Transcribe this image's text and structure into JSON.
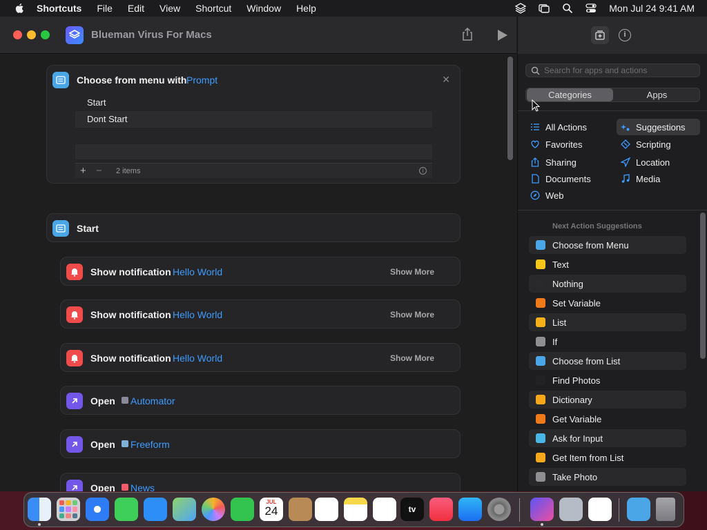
{
  "menubar": {
    "app": "Shortcuts",
    "items": [
      "File",
      "Edit",
      "View",
      "Shortcut",
      "Window",
      "Help"
    ],
    "clock": "Mon Jul 24  9:41 AM"
  },
  "window": {
    "title": "Blueman Virus For Macs"
  },
  "menu_card": {
    "label": "Choose from menu with",
    "token": "Prompt",
    "items": [
      "Start",
      "Dont Start"
    ],
    "count": "2 items"
  },
  "start_header": {
    "label": "Start"
  },
  "actions": [
    {
      "label": "Show notification",
      "token": "Hello World",
      "more": "Show More"
    },
    {
      "label": "Show notification",
      "token": "Hello World",
      "more": "Show More"
    },
    {
      "label": "Show notification",
      "token": "Hello World",
      "more": "Show More"
    },
    {
      "label": "Open",
      "token": "Automator"
    },
    {
      "label": "Open",
      "token": "Freeform"
    },
    {
      "label": "Open",
      "token": "News"
    }
  ],
  "sidebar": {
    "search_placeholder": "Search for apps and actions",
    "seg_categories": "Categories",
    "seg_apps": "Apps",
    "categories_left": [
      "All Actions",
      "Favorites",
      "Sharing",
      "Documents",
      "Web"
    ],
    "categories_right": [
      "Suggestions",
      "Scripting",
      "Location",
      "Media"
    ],
    "next_title": "Next Action Suggestions",
    "suggestions": [
      {
        "label": "Choose from Menu",
        "color": "#4aa6e6"
      },
      {
        "label": "Text",
        "color": "#f5c518"
      },
      {
        "label": "Nothing",
        "color": "#2a2a2c"
      },
      {
        "label": "Set Variable",
        "color": "#f07a1a"
      },
      {
        "label": "List",
        "color": "#f5b01a"
      },
      {
        "label": "If",
        "color": "#8e8e93"
      },
      {
        "label": "Choose from List",
        "color": "#4aa6e6"
      },
      {
        "label": "Find Photos",
        "color": "#222224"
      },
      {
        "label": "Dictionary",
        "color": "#f5a81a"
      },
      {
        "label": "Get Variable",
        "color": "#f07a1a"
      },
      {
        "label": "Ask for Input",
        "color": "#4ab6e6"
      },
      {
        "label": "Get Item from List",
        "color": "#f5a81a"
      },
      {
        "label": "Take Photo",
        "color": "#8e8e93"
      }
    ]
  },
  "dock": {
    "calendar_month": "JUL",
    "calendar_day": "24",
    "tv_label": "tv"
  }
}
